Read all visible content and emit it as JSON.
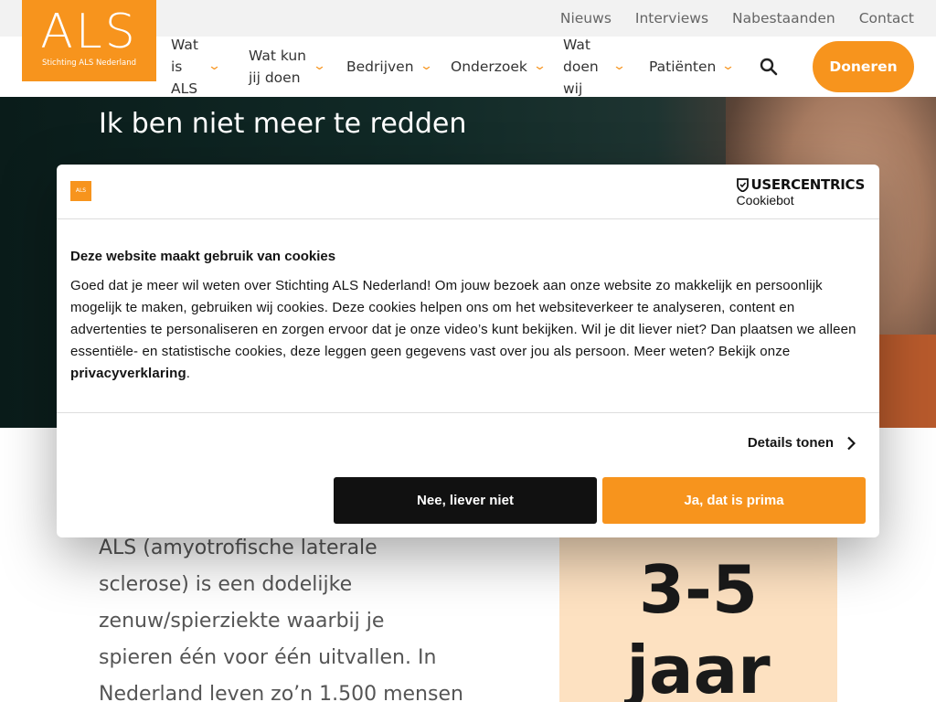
{
  "utility_nav": [
    "Nieuws",
    "Interviews",
    "Nabestaanden",
    "Contact"
  ],
  "logo": {
    "mark": "ALS",
    "subtitle": "Stichting ALS Nederland"
  },
  "main_nav": {
    "items": [
      "Wat is ALS",
      "Wat kun jij doen",
      "Bedrijven",
      "Onderzoek",
      "Wat doen wij",
      "Patiënten"
    ],
    "donate_label": "Doneren",
    "search_icon": "search-icon"
  },
  "hero": {
    "title": "Ik ben niet meer te redden"
  },
  "content": {
    "intro_text": "ALS (amyotrofische laterale sclerose) is een dodelijke zenuw/spierziekte waarbij je spieren één voor één uitvallen. In Nederland leven zo’n 1.500 mensen",
    "stat_value": "3-5",
    "stat_unit": "jaar"
  },
  "cookie_dialog": {
    "logo_text": "ALS",
    "brand_line1": "USERCENTRICS",
    "brand_line2": "Cookiebot",
    "title": "Deze website maakt gebruik van cookies",
    "body": "Goed dat je meer wil weten over Stichting ALS Nederland! Om jouw bezoek aan onze website zo makkelijk en persoonlijk mogelijk te maken, gebruiken wij cookies. Deze cookies helpen ons om het websiteverkeer te analyseren, content en advertenties te personaliseren en zorgen ervoor dat je onze video’s kunt bekijken. Wil je dit liever niet? Dan plaatsen we alleen essentiële- en statistische cookies, deze leggen geen gegevens vast over jou als persoon. Meer weten? Bekijk onze ",
    "privacy_link": "privacyverklaring",
    "body_end": ".",
    "details_label": "Details tonen",
    "deny_label": "Nee, liever niet",
    "accept_label": "Ja, dat is prima"
  },
  "colors": {
    "brand": "#f7941d",
    "dark": "#111111",
    "stat_bg": "#fde1c1"
  }
}
